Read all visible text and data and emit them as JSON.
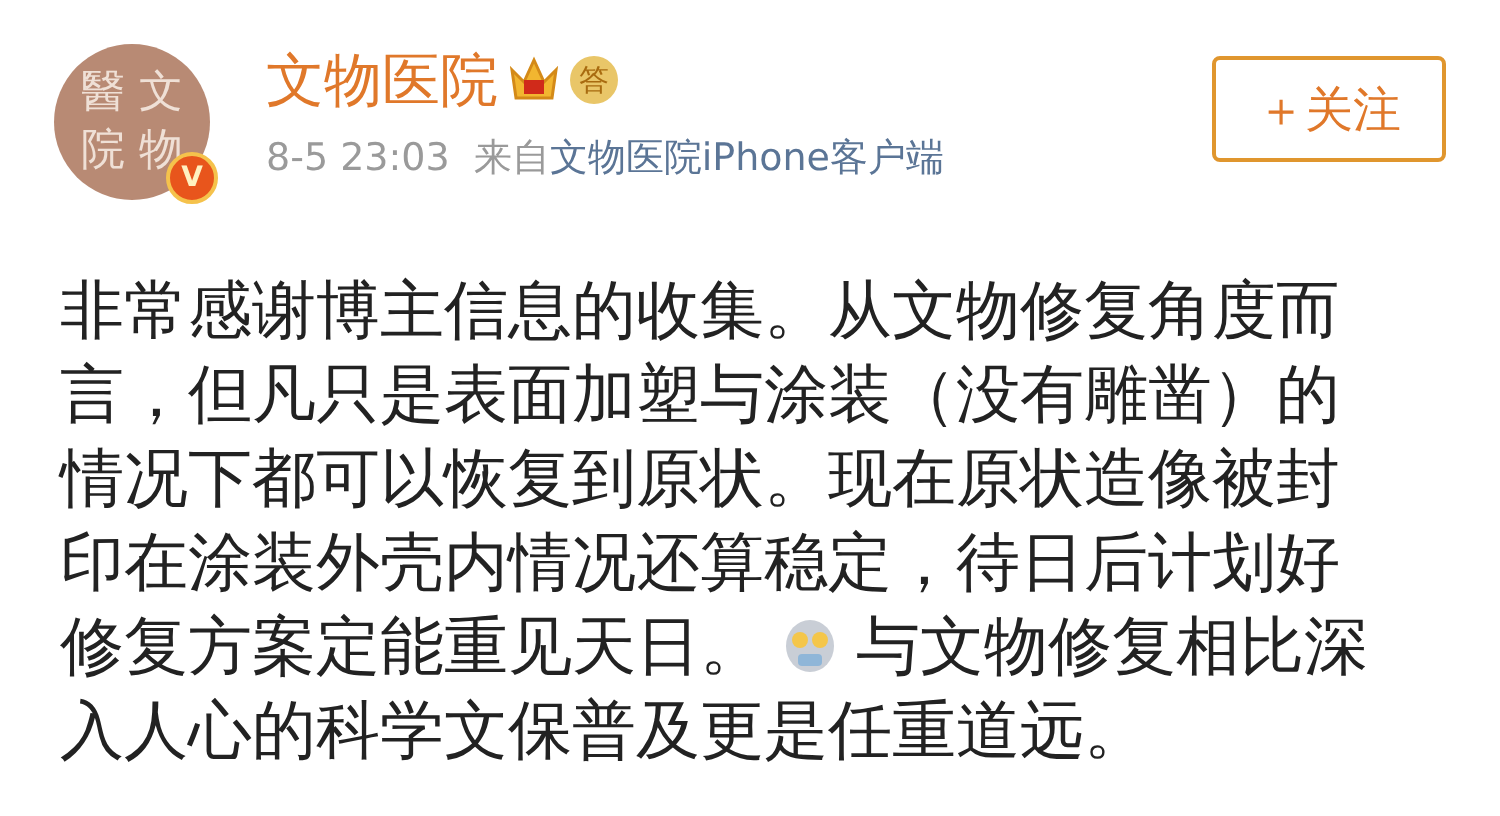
{
  "post": {
    "avatar": {
      "logo_chars": [
        "醫",
        "文",
        "院",
        "物"
      ],
      "verified_mark": "V"
    },
    "author": "文物医院",
    "answer_badge": "答",
    "time": "8-5 23:03",
    "source_prefix": "来自",
    "source_link": "文物医院iPhone客户端",
    "follow_button": "＋关注",
    "body_lines": [
      "非常感谢博主信息的收集。从文物修复角度而",
      "言，但凡只是表面加塑与涂装（没有雕凿）的",
      "情况下都可以恢复到原状。现在原状造像被封",
      "印在涂装外壳内情况还算稳定，待日后计划好"
    ],
    "emoji_line": {
      "before": "修复方案定能重见天日。",
      "after": "与文物修复相比深"
    },
    "last_line": "入人心的科学文保普及更是任重道远。"
  }
}
